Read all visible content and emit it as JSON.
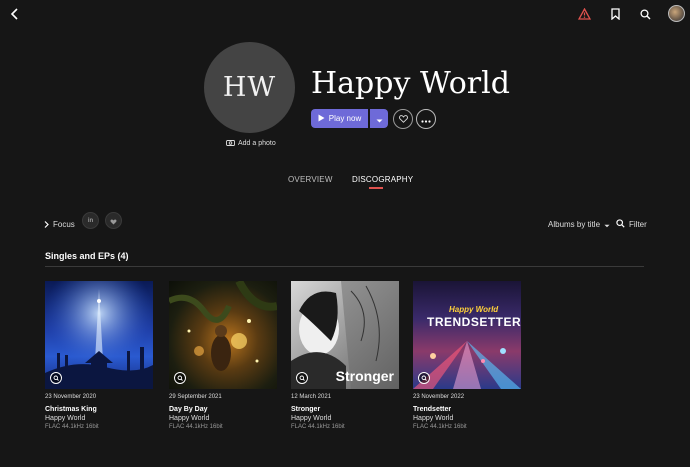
{
  "artist": {
    "initials": "HW",
    "name": "Happy World",
    "add_photo": "Add a photo"
  },
  "actions": {
    "play_label": "Play now"
  },
  "tabs": [
    {
      "label": "OVERVIEW",
      "active": false
    },
    {
      "label": "DISCOGRAPHY",
      "active": true
    }
  ],
  "toolbar": {
    "focus_label": "Focus",
    "sort_label": "Albums by title",
    "filter_label": "Filter"
  },
  "section": {
    "title": "Singles and EPs (4)"
  },
  "albums": [
    {
      "date": "23 November 2020",
      "title": "Christmas King",
      "artist": "Happy World",
      "quality": "FLAC 44.1kHz 16bit"
    },
    {
      "date": "29 September 2021",
      "title": "Day By Day",
      "artist": "Happy World",
      "quality": "FLAC 44.1kHz 16bit"
    },
    {
      "date": "12 March 2021",
      "title": "Stronger",
      "artist": "Happy World",
      "quality": "FLAC 44.1kHz 16bit"
    },
    {
      "date": "23 November 2022",
      "title": "Trendsetter",
      "artist": "Happy World",
      "quality": "FLAC 44.1kHz 16bit"
    }
  ],
  "cover_text": {
    "stronger": "Stronger",
    "trend_top": "Happy World",
    "trend_main": "TRENDSETTER"
  },
  "colors": {
    "accent": "#6e6ad8",
    "tab_underline": "#e0524e",
    "warning": "#e0524e"
  },
  "icons": [
    "back-arrow-icon",
    "warning-icon",
    "bookmark-icon",
    "search-icon",
    "user-avatar",
    "camera-icon",
    "play-icon",
    "chevron-down-icon",
    "heart-icon",
    "more-icon",
    "chevron-right-icon",
    "linkedin-icon",
    "filter-icon"
  ]
}
